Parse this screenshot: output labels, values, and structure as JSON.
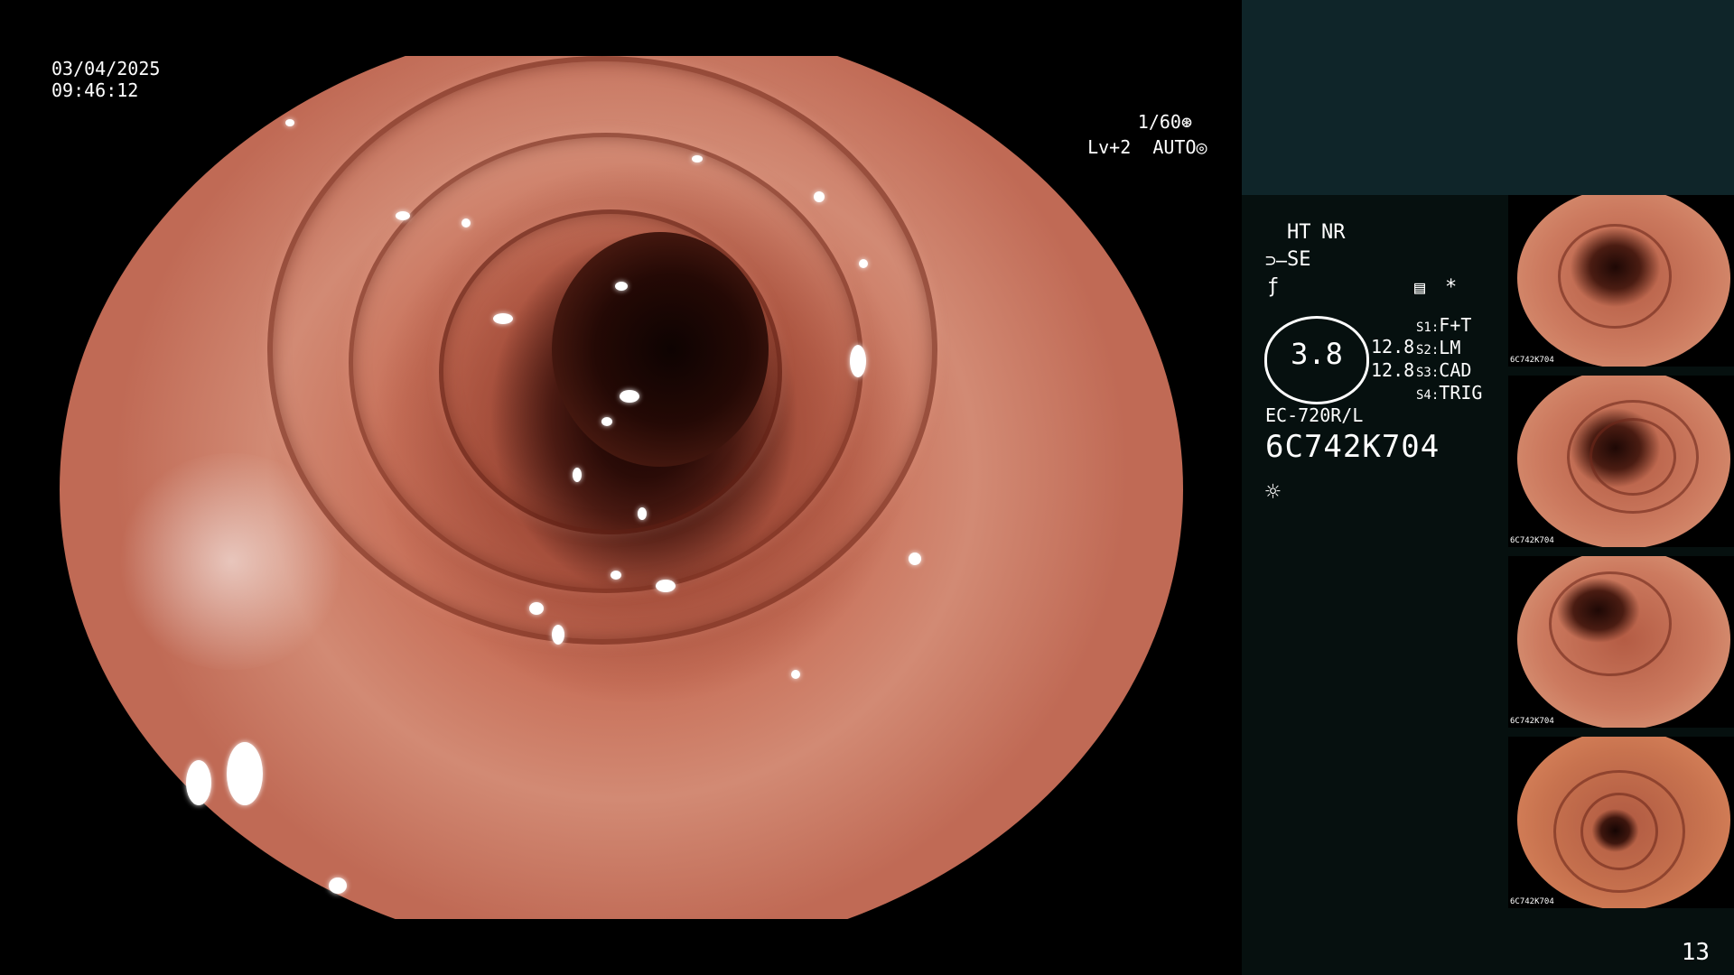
{
  "overlay": {
    "date": "03/04/2025",
    "time": "09:46:12",
    "shutter": "1/60",
    "exposure": "Lv+2  AUTO"
  },
  "panel": {
    "ht": "HT",
    "nr": "NR",
    "se": "SE",
    "gauge_value": "3.8",
    "gauge_side_1": "12.8",
    "gauge_side_2": "12.8",
    "buttons": [
      {
        "key": "S1:",
        "value": "F+T"
      },
      {
        "key": "S2:",
        "value": "LM"
      },
      {
        "key": "S3:",
        "value": "CAD"
      },
      {
        "key": "S4:",
        "value": "TRIG"
      }
    ],
    "model": "EC-720R/L",
    "serial": "6C742K704",
    "asterisk": "*"
  },
  "thumbnails": [
    {
      "id": "6C742K704"
    },
    {
      "id": "6C742K704"
    },
    {
      "id": "6C742K704"
    },
    {
      "id": "6C742K704"
    }
  ],
  "page_number": "13",
  "colors": {
    "accent_yellow": "#f3c144",
    "panel_bg": "#06100f",
    "panel_top_bg": "#0f2529"
  }
}
